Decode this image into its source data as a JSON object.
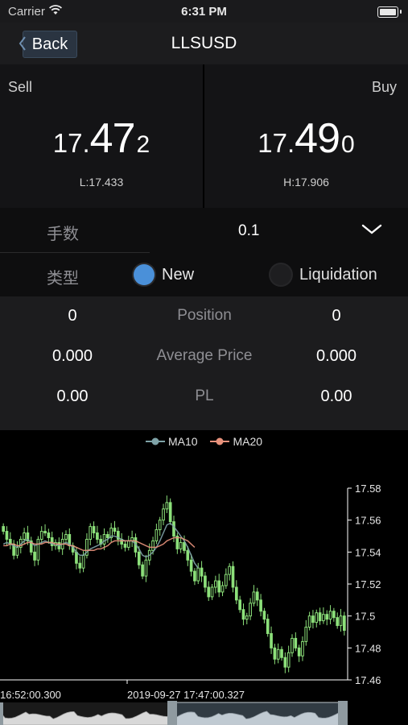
{
  "status_bar": {
    "carrier": "Carrier",
    "time": "6:31 PM"
  },
  "nav": {
    "back_label": "Back",
    "title": "LLSUSD"
  },
  "sell": {
    "label": "Sell",
    "price_int": "17.",
    "price_big": "47",
    "price_last": "2",
    "low": "L:17.433"
  },
  "buy": {
    "label": "Buy",
    "price_int": "17.",
    "price_big": "49",
    "price_last": "0",
    "high": "H:17.906"
  },
  "order": {
    "lots_label": "手数",
    "lots_value": "0.1",
    "type_label": "类型",
    "type_options": [
      {
        "label": "New",
        "selected": true
      },
      {
        "label": "Liquidation",
        "selected": false
      }
    ]
  },
  "positions": [
    {
      "left": "0",
      "label": "Position",
      "right": "0"
    },
    {
      "left": "0.000",
      "label": "Average Price",
      "right": "0.000"
    },
    {
      "left": "0.00",
      "label": "PL",
      "right": "0.00"
    }
  ],
  "chart_data": {
    "type": "candlestick",
    "series": [
      {
        "name": "MA10",
        "color": "#7fa3a8"
      },
      {
        "name": "MA20",
        "color": "#e9927c"
      }
    ],
    "ylim": [
      17.46,
      17.58
    ],
    "yticks": [
      "17.58",
      "17.56",
      "17.54",
      "17.52",
      "17.5",
      "17.48",
      "17.46"
    ],
    "xticks": [
      "16:52:00.300",
      "2019-09-27 17:47:00.327"
    ],
    "candle_color": "#8ce07a",
    "close_values": [
      17.553,
      17.548,
      17.545,
      17.538,
      17.543,
      17.548,
      17.552,
      17.547,
      17.54,
      17.535,
      17.548,
      17.553,
      17.552,
      17.549,
      17.544,
      17.546,
      17.542,
      17.548,
      17.551,
      17.544,
      17.54,
      17.533,
      17.53,
      17.538,
      17.548,
      17.556,
      17.552,
      17.548,
      17.545,
      17.551,
      17.549,
      17.555,
      17.553,
      17.548,
      17.545,
      17.543,
      17.547,
      17.549,
      17.54,
      17.532,
      17.525,
      17.535,
      17.541,
      17.547,
      17.554,
      17.56,
      17.567,
      17.571,
      17.559,
      17.55,
      17.542,
      17.546,
      17.541,
      17.535,
      17.528,
      17.522,
      17.53,
      17.525,
      17.518,
      17.512,
      17.518,
      17.522,
      17.515,
      17.519,
      17.526,
      17.531,
      17.518,
      17.51,
      17.504,
      17.498,
      17.5,
      17.508,
      17.515,
      17.51,
      17.503,
      17.498,
      17.489,
      17.48,
      17.473,
      17.479,
      17.474,
      17.468,
      17.477,
      17.486,
      17.48,
      17.475,
      17.484,
      17.493,
      17.5,
      17.496,
      17.502,
      17.497,
      17.501,
      17.498,
      17.503,
      17.499,
      17.494,
      17.5,
      17.491
    ],
    "ma10_values": [
      17.545,
      17.546,
      17.545,
      17.544,
      17.543,
      17.545,
      17.547,
      17.548,
      17.546,
      17.544,
      17.545,
      17.546,
      17.547,
      17.546,
      17.545,
      17.545,
      17.544,
      17.545,
      17.546,
      17.545,
      17.543,
      17.54,
      17.538,
      17.538,
      17.54,
      17.542,
      17.543,
      17.544,
      17.545,
      17.547,
      17.548,
      17.55,
      17.55,
      17.549,
      17.548,
      17.547,
      17.547,
      17.547,
      17.545,
      17.542,
      17.538,
      17.537,
      17.538,
      17.54,
      17.543,
      17.547,
      17.552,
      17.557,
      17.558,
      17.556,
      17.553,
      17.55,
      17.547,
      17.543,
      17.538,
      17.533,
      17.53
    ],
    "ma20_values": [
      17.544,
      17.544,
      17.545,
      17.545,
      17.544,
      17.544,
      17.545,
      17.546,
      17.546,
      17.545,
      17.545,
      17.545,
      17.546,
      17.546,
      17.546,
      17.545,
      17.545,
      17.545,
      17.545,
      17.544,
      17.544,
      17.543,
      17.542,
      17.541,
      17.541,
      17.541,
      17.541,
      17.542,
      17.542,
      17.543,
      17.544,
      17.546,
      17.547,
      17.547,
      17.547,
      17.547,
      17.547,
      17.547,
      17.547,
      17.546,
      17.545,
      17.544,
      17.543,
      17.543,
      17.543,
      17.544,
      17.545,
      17.547,
      17.548,
      17.549,
      17.549,
      17.549,
      17.548,
      17.547,
      17.545,
      17.543
    ]
  }
}
